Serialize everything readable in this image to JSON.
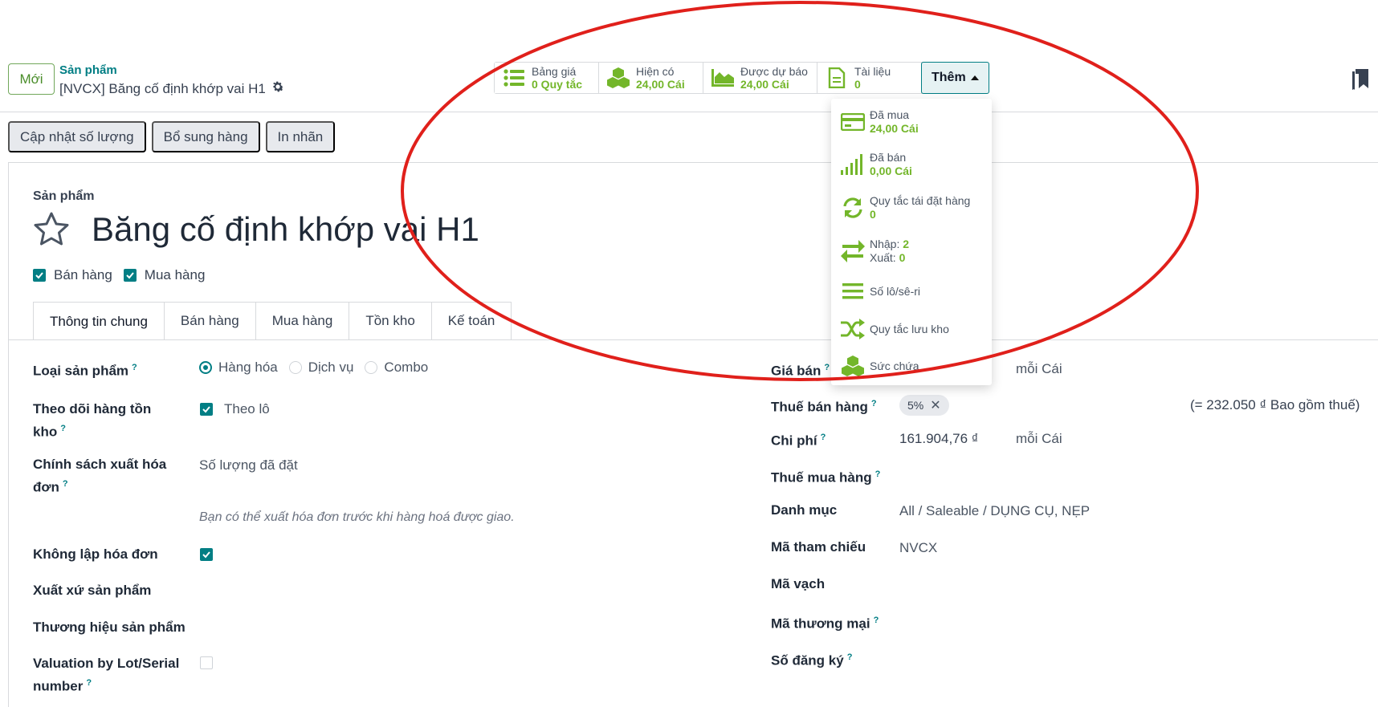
{
  "header": {
    "new_button": "Mới",
    "breadcrumb_parent": "Sản phẩm",
    "breadcrumb_current": "[NVCX] Băng cố định khớp vai H1"
  },
  "stats": [
    {
      "label": "Bảng giá",
      "value": "0 Quy tắc",
      "icon": "list-icon"
    },
    {
      "label": "Hiện có",
      "value": "24,00 Cái",
      "icon": "cubes-icon"
    },
    {
      "label": "Được dự báo",
      "value": "24,00 Cái",
      "icon": "area-chart-icon"
    },
    {
      "label": "Tài liệu",
      "value": "0",
      "icon": "file-icon"
    }
  ],
  "more_button": "Thêm",
  "dropdown": {
    "items": [
      {
        "label": "Đã mua",
        "value": "24,00 Cái",
        "icon": "credit-card-icon"
      },
      {
        "label": "Đã bán",
        "value": "0,00 Cái",
        "icon": "signal-icon"
      },
      {
        "label": "Quy tắc tái đặt hàng",
        "value": "0",
        "icon": "refresh-icon"
      },
      {
        "label": "Nhập:",
        "value": "2",
        "label2": "Xuất:",
        "value2": "0",
        "icon": "exchange-icon"
      },
      {
        "label": "Số lô/sê-ri",
        "icon": "bars-icon"
      },
      {
        "label": "Quy tắc lưu kho",
        "icon": "random-icon"
      },
      {
        "label": "Sức chứa",
        "icon": "cubes-icon"
      }
    ]
  },
  "actions": [
    "Cập nhật số lượng",
    "Bổ sung hàng",
    "In nhãn"
  ],
  "form": {
    "section_label": "Sản phẩm",
    "title": "Băng cố định khớp vai H1",
    "flags": [
      "Bán hàng",
      "Mua hàng"
    ],
    "tabs": [
      "Thông tin chung",
      "Bán hàng",
      "Mua hàng",
      "Tồn kho",
      "Kế toán"
    ],
    "left": {
      "product_type_label": "Loại sản phẩm",
      "product_type_options": [
        "Hàng hóa",
        "Dịch vụ",
        "Combo"
      ],
      "track_inventory_label_1": "Theo dõi hàng tồn",
      "track_inventory_label_2": "kho",
      "track_by_lot": "Theo lô",
      "invoice_policy_label_1": "Chính sách xuất hóa",
      "invoice_policy_label_2": "đơn",
      "invoice_policy_value": "Số lượng đã đặt",
      "invoice_hint": "Bạn có thể xuất hóa đơn trước khi hàng hoá được giao.",
      "no_invoice_label": "Không lập hóa đơn",
      "origin_label": "Xuất xứ sản phẩm",
      "brand_label": "Thương hiệu sản phẩm",
      "valuation_label_1": "Valuation by Lot/Serial",
      "valuation_label_2": "number"
    },
    "right": {
      "sale_price_label": "Giá bán",
      "sale_price_unit": "mỗi Cái",
      "sale_tax_label": "Thuế bán hàng",
      "sale_tax_tag": "5%",
      "sale_tax_note": "(= 232.050 ₫ Bao gồm thuế)",
      "cost_label": "Chi phí",
      "cost_value": "161.904,76 ₫",
      "cost_unit": "mỗi Cái",
      "purchase_tax_label": "Thuế mua hàng",
      "category_label": "Danh mục",
      "category_value": "All / Saleable / DỤNG CỤ, NẸP",
      "ref_label": "Mã tham chiếu",
      "ref_value": "NVCX",
      "barcode_label": "Mã vạch",
      "trade_code_label": "Mã thương mại",
      "reg_no_label": "Số đăng ký"
    }
  },
  "colors": {
    "accent": "#017e84",
    "stat_value": "#73b62a",
    "annotation": "#e0201b"
  }
}
